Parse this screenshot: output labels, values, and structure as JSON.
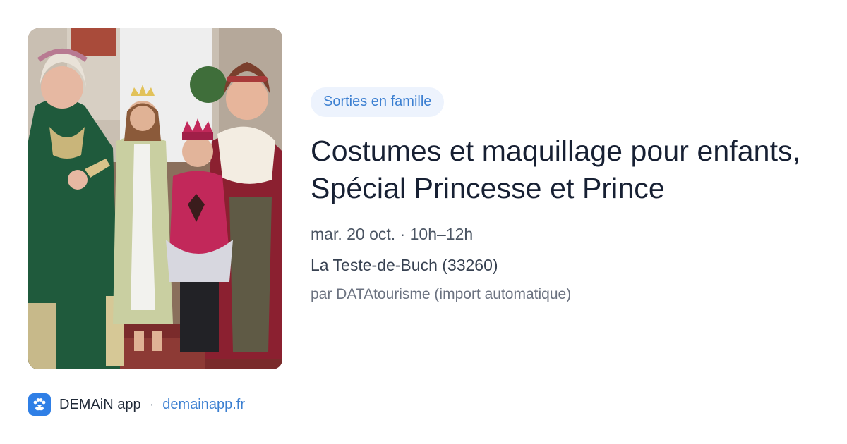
{
  "event": {
    "image_alt": "Personnes en costumes médiévaux de princesse et de prince",
    "category": "Sorties en famille",
    "title": "Costumes et maquillage pour enfants, Spécial Princesse et Prince",
    "datetime": "mar. 20 oct. · 10h–12h",
    "location": "La Teste-de-Buch (33260)",
    "source": "par DATAtourisme (import automatique)"
  },
  "footer": {
    "app_icon": "paw-icon",
    "app_name": "DEMAiN app",
    "separator": "·",
    "link": "demainapp.fr"
  },
  "colors": {
    "accent": "#3b7fd1",
    "tag_bg": "#edf3fd",
    "title": "#172033"
  }
}
